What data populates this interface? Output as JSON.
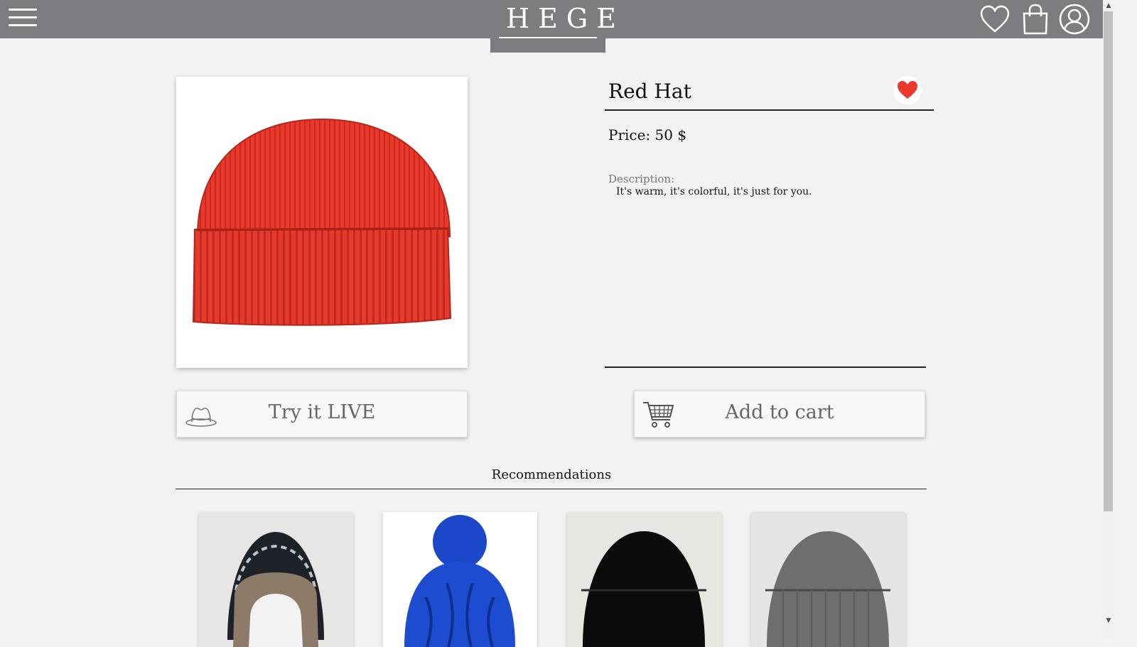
{
  "header": {
    "logo": "HEGE",
    "icons": [
      "menu-icon",
      "heart-icon",
      "shopping-bag-icon",
      "user-icon"
    ]
  },
  "product": {
    "title": "Red Hat",
    "price": "Price: 50 $",
    "description_label": "Description:",
    "description": "It's warm, it's colorful, it's just for you.",
    "image": "red-knit-beanie",
    "favorited": true
  },
  "actions": {
    "try_live_label": "Try it LIVE",
    "add_to_cart_label": "Add to cart"
  },
  "recommendations": {
    "title": "Recommendations",
    "items": [
      {
        "image": "patterned-trapper-hat"
      },
      {
        "image": "blue-pom-pom-beanie"
      },
      {
        "image": "black-beanie"
      },
      {
        "image": "grey-beanie"
      }
    ]
  },
  "colors": {
    "header_bg": "#7c7d80",
    "page_bg": "#f2f2f2",
    "favorite_heart": "#e8392c",
    "product_red": "#e8392c"
  }
}
